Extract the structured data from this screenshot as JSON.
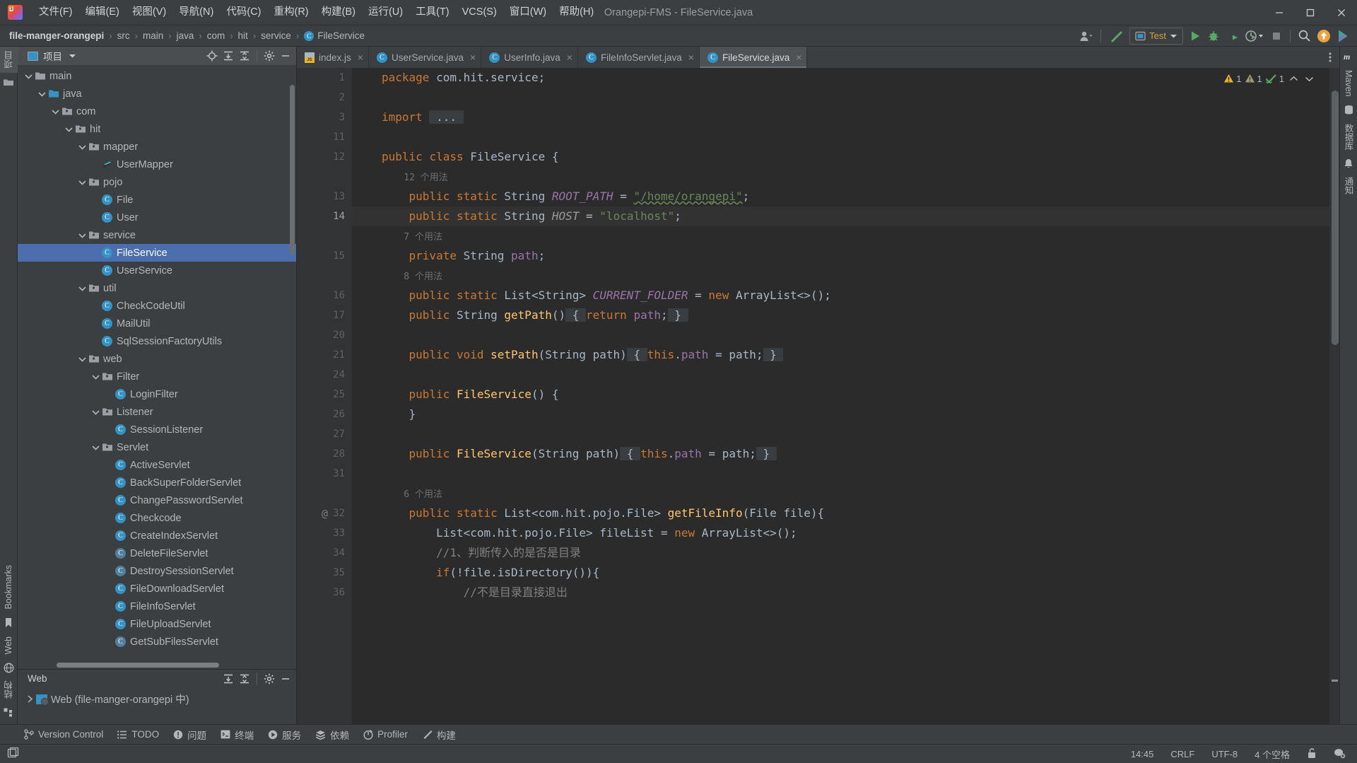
{
  "window": {
    "title": "Orangepi-FMS - FileService.java",
    "logo_icon": "intellij-idea-logo"
  },
  "menu": [
    {
      "label": "文件(F)",
      "name": "menu-file"
    },
    {
      "label": "编辑(E)",
      "name": "menu-edit"
    },
    {
      "label": "视图(V)",
      "name": "menu-view"
    },
    {
      "label": "导航(N)",
      "name": "menu-navigate"
    },
    {
      "label": "代码(C)",
      "name": "menu-code"
    },
    {
      "label": "重构(R)",
      "name": "menu-refactor"
    },
    {
      "label": "构建(B)",
      "name": "menu-build"
    },
    {
      "label": "运行(U)",
      "name": "menu-run"
    },
    {
      "label": "工具(T)",
      "name": "menu-tools"
    },
    {
      "label": "VCS(S)",
      "name": "menu-vcs"
    },
    {
      "label": "窗口(W)",
      "name": "menu-window"
    },
    {
      "label": "帮助(H)",
      "name": "menu-help"
    }
  ],
  "breadcrumbs": [
    {
      "label": "file-manger-orangepi",
      "bold": true
    },
    {
      "label": "src",
      "bold": false
    },
    {
      "label": "main",
      "bold": false
    },
    {
      "label": "java",
      "bold": false
    },
    {
      "label": "com",
      "bold": false
    },
    {
      "label": "hit",
      "bold": false
    },
    {
      "label": "service",
      "bold": false
    },
    {
      "label": "FileService",
      "bold": false,
      "icon": "class-icon"
    }
  ],
  "toolbar": {
    "run_config": "Test",
    "icons": [
      "account-icon",
      "build-hammer-icon",
      "run-icon",
      "debug-icon",
      "run-coverage-icon",
      "profiler-icon",
      "stop-icon",
      "search-icon",
      "update-project-icon",
      "idea-feature-icon"
    ]
  },
  "left_strip": {
    "top": [
      {
        "label": "项目",
        "icon": "project-icon",
        "active": true,
        "name": "tool-project"
      },
      {
        "label": "",
        "icon": "folder-icon",
        "active": false,
        "name": "tool-commit"
      }
    ],
    "bottom": [
      {
        "label": "Bookmarks",
        "icon": "bookmark-icon",
        "name": "tool-bookmarks"
      },
      {
        "label": "Web",
        "icon": "web-globe-icon",
        "name": "tool-web"
      },
      {
        "label": "结构",
        "icon": "structure-icon",
        "name": "tool-structure"
      }
    ]
  },
  "right_strip": [
    {
      "label": "Maven",
      "icon": "maven-m-icon",
      "name": "tool-maven"
    },
    {
      "label": "数据库",
      "icon": "database-icon",
      "name": "tool-database"
    },
    {
      "label": "通知",
      "icon": "bell-icon",
      "name": "tool-notifications"
    }
  ],
  "project_panel": {
    "title": "项目",
    "actions": [
      "locate-target-icon",
      "expand-all-icon",
      "collapse-all-icon",
      "gear-icon",
      "minimize-icon"
    ],
    "tree": [
      {
        "label": "main",
        "depth": 0,
        "icon": "folder",
        "expanded": true,
        "sel": false
      },
      {
        "label": "java",
        "depth": 1,
        "icon": "folder-src",
        "expanded": true,
        "sel": false
      },
      {
        "label": "com",
        "depth": 2,
        "icon": "package",
        "expanded": true,
        "sel": false
      },
      {
        "label": "hit",
        "depth": 3,
        "icon": "package",
        "expanded": true,
        "sel": false
      },
      {
        "label": "mapper",
        "depth": 4,
        "icon": "package",
        "expanded": true,
        "sel": false
      },
      {
        "label": "UserMapper",
        "depth": 5,
        "icon": "mybatis",
        "expanded": null,
        "sel": false
      },
      {
        "label": "pojo",
        "depth": 4,
        "icon": "package",
        "expanded": true,
        "sel": false
      },
      {
        "label": "File",
        "depth": 5,
        "icon": "class",
        "expanded": null,
        "sel": false
      },
      {
        "label": "User",
        "depth": 5,
        "icon": "class",
        "expanded": null,
        "sel": false
      },
      {
        "label": "service",
        "depth": 4,
        "icon": "package",
        "expanded": true,
        "sel": false
      },
      {
        "label": "FileService",
        "depth": 5,
        "icon": "class",
        "expanded": null,
        "sel": true
      },
      {
        "label": "UserService",
        "depth": 5,
        "icon": "class",
        "expanded": null,
        "sel": false
      },
      {
        "label": "util",
        "depth": 4,
        "icon": "package",
        "expanded": true,
        "sel": false
      },
      {
        "label": "CheckCodeUtil",
        "depth": 5,
        "icon": "class",
        "expanded": null,
        "sel": false
      },
      {
        "label": "MailUtil",
        "depth": 5,
        "icon": "class",
        "expanded": null,
        "sel": false
      },
      {
        "label": "SqlSessionFactoryUtils",
        "depth": 5,
        "icon": "class",
        "expanded": null,
        "sel": false
      },
      {
        "label": "web",
        "depth": 4,
        "icon": "package",
        "expanded": true,
        "sel": false
      },
      {
        "label": "Filter",
        "depth": 5,
        "icon": "package",
        "expanded": true,
        "sel": false
      },
      {
        "label": "LoginFilter",
        "depth": 6,
        "icon": "class",
        "expanded": null,
        "sel": false
      },
      {
        "label": "Listener",
        "depth": 5,
        "icon": "package",
        "expanded": true,
        "sel": false
      },
      {
        "label": "SessionListener",
        "depth": 6,
        "icon": "class",
        "expanded": null,
        "sel": false
      },
      {
        "label": "Servlet",
        "depth": 5,
        "icon": "package",
        "expanded": true,
        "sel": false
      },
      {
        "label": "ActiveServlet",
        "depth": 6,
        "icon": "class",
        "expanded": null,
        "sel": false
      },
      {
        "label": "BackSuperFolderServlet",
        "depth": 6,
        "icon": "class",
        "expanded": null,
        "sel": false
      },
      {
        "label": "ChangePasswordServlet",
        "depth": 6,
        "icon": "class",
        "expanded": null,
        "sel": false
      },
      {
        "label": "Checkcode",
        "depth": 6,
        "icon": "class",
        "expanded": null,
        "sel": false
      },
      {
        "label": "CreateIndexServlet",
        "depth": 6,
        "icon": "class",
        "expanded": null,
        "sel": false
      },
      {
        "label": "DeleteFileServlet",
        "depth": 6,
        "icon": "class-dim",
        "expanded": null,
        "sel": false
      },
      {
        "label": "DestroySessionServlet",
        "depth": 6,
        "icon": "class-dim",
        "expanded": null,
        "sel": false
      },
      {
        "label": "FileDownloadServlet",
        "depth": 6,
        "icon": "class",
        "expanded": null,
        "sel": false
      },
      {
        "label": "FileInfoServlet",
        "depth": 6,
        "icon": "class",
        "expanded": null,
        "sel": false
      },
      {
        "label": "FileUploadServlet",
        "depth": 6,
        "icon": "class",
        "expanded": null,
        "sel": false
      },
      {
        "label": "GetSubFilesServlet",
        "depth": 6,
        "icon": "class-dim",
        "expanded": null,
        "sel": false
      }
    ]
  },
  "web_panel": {
    "title": "Web",
    "node": "Web (file-manger-orangepi 中)",
    "actions": [
      "expand-all-icon",
      "collapse-all-icon",
      "gear-icon",
      "minimize-icon"
    ]
  },
  "editor_tabs": [
    {
      "label": "index.js",
      "icon": "js-icon",
      "active": false
    },
    {
      "label": "UserService.java",
      "icon": "class-icon",
      "active": false
    },
    {
      "label": "UserInfo.java",
      "icon": "class-icon",
      "active": false
    },
    {
      "label": "FileInfoServlet.java",
      "icon": "class-icon",
      "active": false
    },
    {
      "label": "FileService.java",
      "icon": "class-icon",
      "active": true
    }
  ],
  "inspection": {
    "warnings": "1",
    "weak_warnings": "1",
    "ok": "1"
  },
  "code": [
    {
      "num": "1",
      "fold": "",
      "hl": false,
      "at": false,
      "html": "<span class=\"kw\">package</span> <span class=\"plain\">com.hit.service;</span>"
    },
    {
      "num": "2",
      "fold": "",
      "hl": false,
      "at": false,
      "html": ""
    },
    {
      "num": "3",
      "fold": "plus",
      "hl": false,
      "at": false,
      "html": "<span class=\"kw\">import</span> <span class=\"brace-box plain\"> ... </span>"
    },
    {
      "num": "11",
      "fold": "",
      "hl": false,
      "at": false,
      "html": ""
    },
    {
      "num": "12",
      "fold": "",
      "hl": false,
      "at": false,
      "html": "<span class=\"kw\">public</span> <span class=\"kw\">class</span> <span class=\"plain\">FileService {</span>"
    },
    {
      "num": "",
      "fold": "",
      "hl": false,
      "at": false,
      "html": "<span class=\"usage\">    12 个用法</span>"
    },
    {
      "num": "13",
      "fold": "",
      "hl": false,
      "at": false,
      "html": "    <span class=\"kw\">public</span> <span class=\"kw\">static</span> <span class=\"plain\">String</span> <span class=\"stat\">ROOT_PATH</span> <span class=\"plain\">=</span> <span class=\"str squiggle\">\"/home/orangepi\"</span><span class=\"plain\">;</span>"
    },
    {
      "num": "14",
      "fold": "",
      "hl": true,
      "at": false,
      "html": "    <span class=\"kw\">public</span> <span class=\"kw\">static</span> <span class=\"plain\">String</span> <span class=\"statg\">HOST</span> <span class=\"plain\">=</span> <span class=\"str\">\"localhost\"</span><span class=\"plain\">;</span>"
    },
    {
      "num": "",
      "fold": "",
      "hl": false,
      "at": false,
      "html": "<span class=\"usage\">    7 个用法</span>"
    },
    {
      "num": "15",
      "fold": "",
      "hl": false,
      "at": false,
      "html": "    <span class=\"kw\">private</span> <span class=\"plain\">String</span> <span class=\"fld\">path</span><span class=\"plain\">;</span>"
    },
    {
      "num": "",
      "fold": "",
      "hl": false,
      "at": false,
      "html": "<span class=\"usage\">    8 个用法</span>"
    },
    {
      "num": "16",
      "fold": "",
      "hl": false,
      "at": false,
      "html": "    <span class=\"kw\">public</span> <span class=\"kw\">static</span> <span class=\"plain\">List&lt;String&gt;</span> <span class=\"stat\">CURRENT_FOLDER</span> <span class=\"plain\">=</span> <span class=\"kw\">new</span> <span class=\"plain\">ArrayList&lt;&gt;();</span>"
    },
    {
      "num": "17",
      "fold": "plus",
      "hl": false,
      "at": false,
      "html": "    <span class=\"kw\">public</span> <span class=\"plain\">String</span> <span class=\"mth\">getPath</span><span class=\"plain\">()</span><span class=\"brace-box plain\"> { </span><span class=\"kw\">return</span> <span class=\"fld\">path</span><span class=\"plain\">;</span><span class=\"brace-box plain\"> } </span>"
    },
    {
      "num": "20",
      "fold": "",
      "hl": false,
      "at": false,
      "html": ""
    },
    {
      "num": "21",
      "fold": "plus",
      "hl": false,
      "at": false,
      "html": "    <span class=\"kw\">public</span> <span class=\"kw\">void</span> <span class=\"mth\">setPath</span><span class=\"plain\">(String path)</span><span class=\"brace-box plain\"> { </span><span class=\"kw\">this</span><span class=\"plain\">.</span><span class=\"fld\">path</span> <span class=\"plain\">= path;</span><span class=\"brace-box plain\"> } </span>"
    },
    {
      "num": "24",
      "fold": "",
      "hl": false,
      "at": false,
      "html": ""
    },
    {
      "num": "25",
      "fold": "minus",
      "hl": false,
      "at": false,
      "html": "    <span class=\"kw\">public</span> <span class=\"mth\">FileService</span><span class=\"plain\">() {</span>"
    },
    {
      "num": "26",
      "fold": "end",
      "hl": false,
      "at": false,
      "html": "    <span class=\"plain\">}</span>"
    },
    {
      "num": "27",
      "fold": "",
      "hl": false,
      "at": false,
      "html": ""
    },
    {
      "num": "28",
      "fold": "plus",
      "hl": false,
      "at": false,
      "html": "    <span class=\"kw\">public</span> <span class=\"mth\">FileService</span><span class=\"plain\">(String path)</span><span class=\"brace-box plain\"> { </span><span class=\"kw\">this</span><span class=\"plain\">.</span><span class=\"fld\">path</span> <span class=\"plain\">= path;</span><span class=\"brace-box plain\"> } </span>"
    },
    {
      "num": "31",
      "fold": "",
      "hl": false,
      "at": false,
      "html": ""
    },
    {
      "num": "",
      "fold": "",
      "hl": false,
      "at": false,
      "html": "<span class=\"usage\">    6 个用法</span>"
    },
    {
      "num": "32",
      "fold": "minus",
      "hl": false,
      "at": true,
      "html": "    <span class=\"kw\">public</span> <span class=\"kw\">static</span> <span class=\"plain\">List&lt;com.hit.pojo.File&gt;</span> <span class=\"mth\">getFileInfo</span><span class=\"plain\">(File file){</span>"
    },
    {
      "num": "33",
      "fold": "",
      "hl": false,
      "at": false,
      "html": "        <span class=\"plain\">List&lt;com.hit.pojo.File&gt; fileList =</span> <span class=\"kw\">new</span> <span class=\"plain\">ArrayList&lt;&gt;();</span>"
    },
    {
      "num": "34",
      "fold": "",
      "hl": false,
      "at": false,
      "html": "        <span class=\"cmt\">//1、判断传入的是否是目录</span>"
    },
    {
      "num": "35",
      "fold": "minus",
      "hl": false,
      "at": false,
      "html": "        <span class=\"kw\">if</span><span class=\"plain\">(!file.isDirectory()){</span>"
    },
    {
      "num": "36",
      "fold": "",
      "hl": false,
      "at": false,
      "html": "            <span class=\"cmt\">//不是目录直接退出</span>"
    }
  ],
  "bottom_bar": [
    {
      "label": "Version Control",
      "icon": "branch-icon",
      "name": "bottom-version-control"
    },
    {
      "label": "TODO",
      "icon": "list-icon",
      "name": "bottom-todo"
    },
    {
      "label": "问题",
      "icon": "problems-icon",
      "name": "bottom-problems"
    },
    {
      "label": "终端",
      "icon": "terminal-icon",
      "name": "bottom-terminal"
    },
    {
      "label": "服务",
      "icon": "services-icon",
      "name": "bottom-services"
    },
    {
      "label": "依赖",
      "icon": "dependencies-icon",
      "name": "bottom-dependencies"
    },
    {
      "label": "Profiler",
      "icon": "profiler-icon",
      "name": "bottom-profiler"
    },
    {
      "label": "构建",
      "icon": "build-icon",
      "name": "bottom-build"
    }
  ],
  "status_bar": {
    "time": "14:45",
    "line_sep": "CRLF",
    "encoding": "UTF-8",
    "indent": "4 个空格",
    "icons": [
      "lock-icon",
      "branch-config-icon",
      "layout-icon"
    ]
  },
  "colors": {
    "accent": "#4b6eaf",
    "class_badge": "#3592c4",
    "run_green": "#59a869",
    "warning_yellow": "#e8b230",
    "string_green": "#6a8759",
    "keyword_orange": "#cc7832"
  }
}
